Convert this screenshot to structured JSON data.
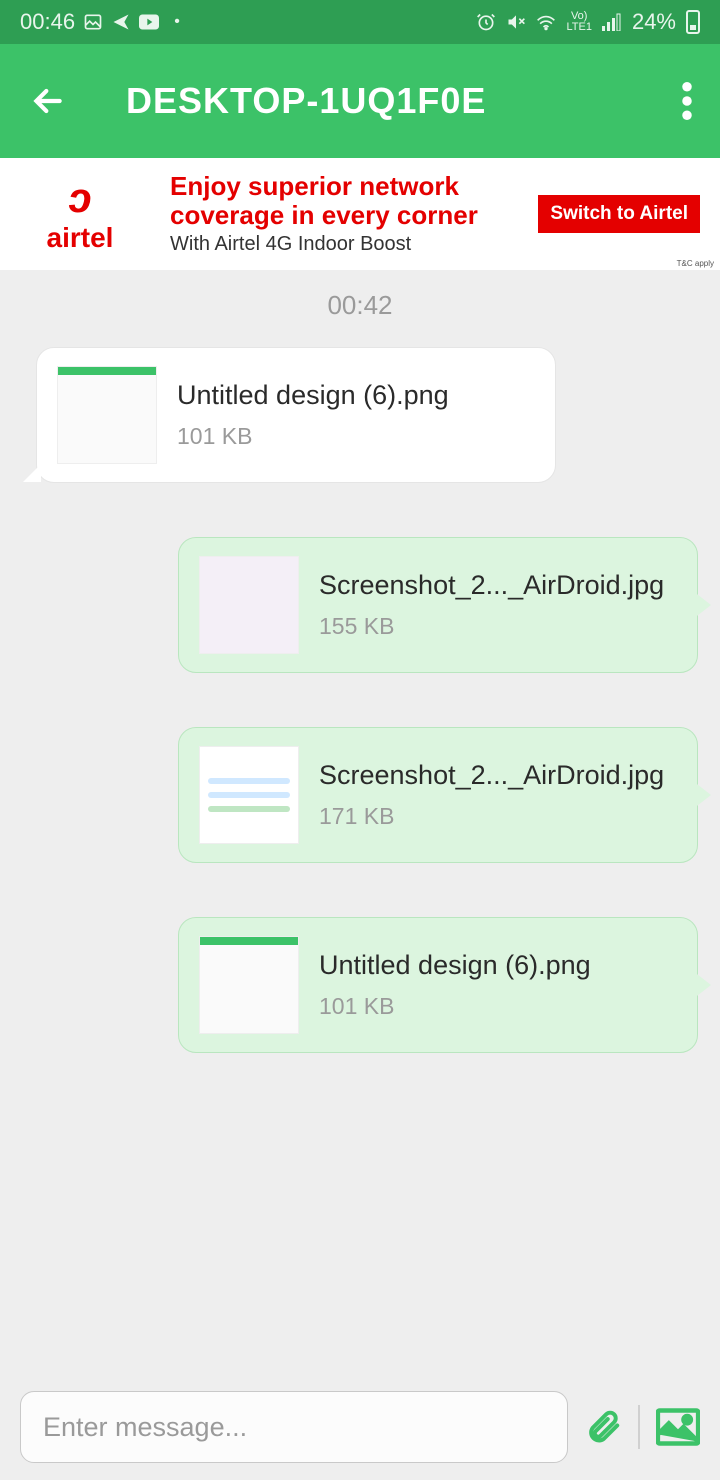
{
  "status": {
    "time": "00:46",
    "battery": "24%"
  },
  "header": {
    "title": "DESKTOP-1UQ1F0E"
  },
  "ad": {
    "brand": "airtel",
    "headline": "Enjoy superior network coverage in every corner",
    "subline": "With Airtel 4G Indoor Boost",
    "cta": "Switch to Airtel",
    "disclaimer": "T&C apply"
  },
  "chat": {
    "timestamp": "00:42",
    "messages": [
      {
        "direction": "in",
        "filename": "Untitled design (6).png",
        "size": "101 KB"
      },
      {
        "direction": "out",
        "filename": "Screenshot_2..._AirDroid.jpg",
        "size": "155 KB"
      },
      {
        "direction": "out",
        "filename": "Screenshot_2..._AirDroid.jpg",
        "size": "171 KB"
      },
      {
        "direction": "out",
        "filename": "Untitled design (6).png",
        "size": "101 KB"
      }
    ]
  },
  "input": {
    "placeholder": "Enter message..."
  }
}
